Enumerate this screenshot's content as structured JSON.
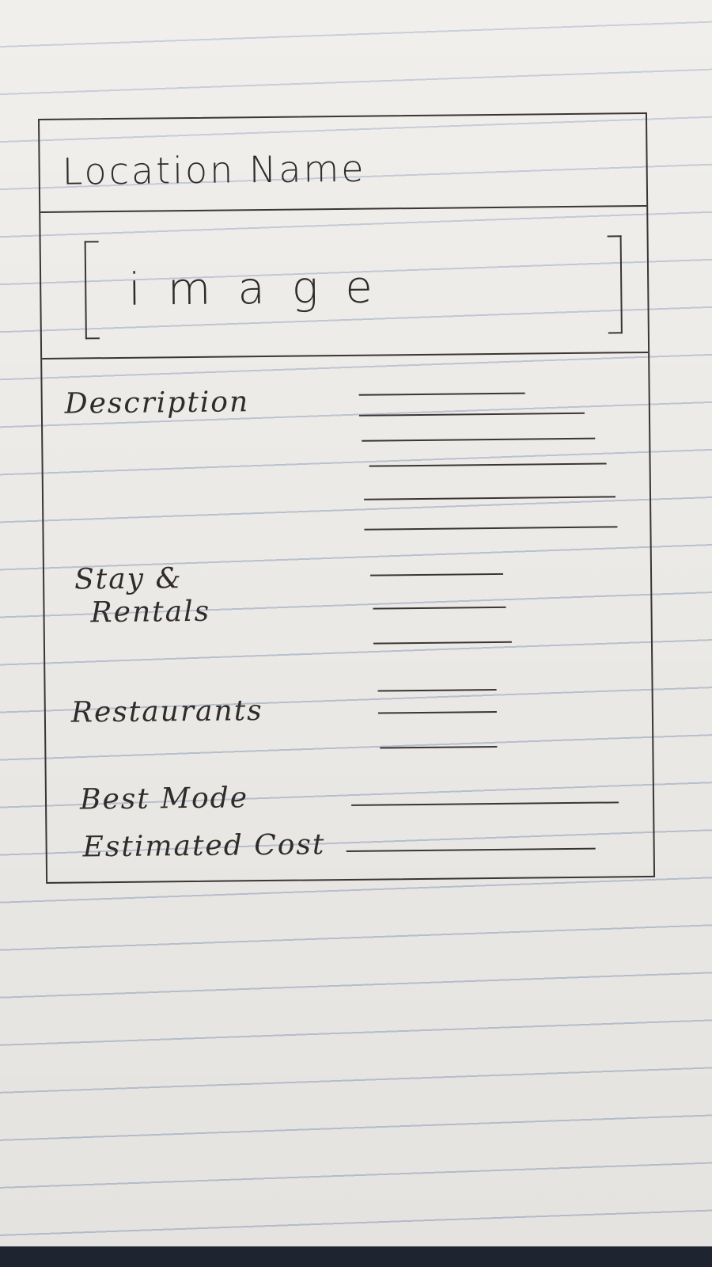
{
  "card": {
    "title": "Location Name",
    "image_placeholder": "image",
    "rows": {
      "description": "Description",
      "stay_rentals_line1": "Stay &",
      "stay_rentals_line2": "Rentals",
      "restaurants": "Restaurants",
      "best_mode": "Best Mode",
      "estimated_cost": "Estimated Cost"
    }
  }
}
